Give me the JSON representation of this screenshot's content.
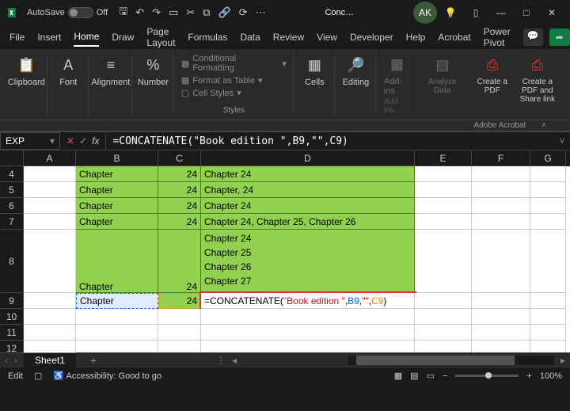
{
  "title": {
    "autosave": "AutoSave",
    "autosave_state": "Off",
    "doc": "Conc…"
  },
  "tabs": {
    "file": "File",
    "insert": "Insert",
    "home": "Home",
    "draw": "Draw",
    "page": "Page Layout",
    "formulas": "Formulas",
    "data": "Data",
    "review": "Review",
    "view": "View",
    "developer": "Developer",
    "help": "Help",
    "acrobat": "Acrobat",
    "power": "Power Pivot"
  },
  "ribbon": {
    "clipboard": "Clipboard",
    "font": "Font",
    "alignment": "Alignment",
    "number": "Number",
    "cond": "Conditional Formatting",
    "table": "Format as Table",
    "styles": "Cell Styles",
    "styles_label": "Styles",
    "cells": "Cells",
    "editing": "Editing",
    "addins": "Add-ins",
    "addins_label": "Add-ins",
    "analyze": "Analyze Data",
    "pdf": "Create a PDF",
    "pdf2": "Create a PDF and Share link",
    "adobe": "Adobe Acrobat"
  },
  "namebox": "EXP",
  "formula_plain": "=CONCATENATE(\"Book edition \",B9,\"\",C9)",
  "cols": {
    "A": "A",
    "B": "B",
    "C": "C",
    "D": "D",
    "E": "E",
    "F": "F",
    "G": "G"
  },
  "rows": {
    "r4": "4",
    "r5": "5",
    "r6": "6",
    "r7": "7",
    "r8": "8",
    "r9": "9",
    "r10": "10",
    "r11": "11",
    "r12": "12"
  },
  "data": {
    "b4": "Chapter",
    "c4": "24",
    "d4": "Chapter 24",
    "b5": "Chapter",
    "c5": "24",
    "d5": "Chapter, 24",
    "b6": "Chapter",
    "c6": "24",
    "d6": "Chapter 24",
    "b7": "Chapter",
    "c7": "24",
    "d7": "Chapter 24, Chapter 25, Chapter 26",
    "b8": "Chapter",
    "c8": "24",
    "d8a": "Chapter 24",
    "d8b": "Chapter 25",
    "d8c": "Chapter 26",
    "d8d": "Chapter 27",
    "b9": "Chapter",
    "c9": "24"
  },
  "d9": {
    "fn": "=CONCATENATE(",
    "str1": "\"Book edition \"",
    "c1": ",",
    "ref1": "B9",
    "c2": ",",
    "str2": "\"\"",
    "c3": ",",
    "ref2": "C9",
    "close": ")"
  },
  "sheet": "Sheet1",
  "status": {
    "mode": "Edit",
    "access": "Accessibility: Good to go",
    "zoom": "100%"
  },
  "avatar": "AK",
  "col_widths": {
    "A": 66,
    "B": 104,
    "C": 54,
    "D": 270,
    "E": 72,
    "F": 74,
    "G": 45
  }
}
